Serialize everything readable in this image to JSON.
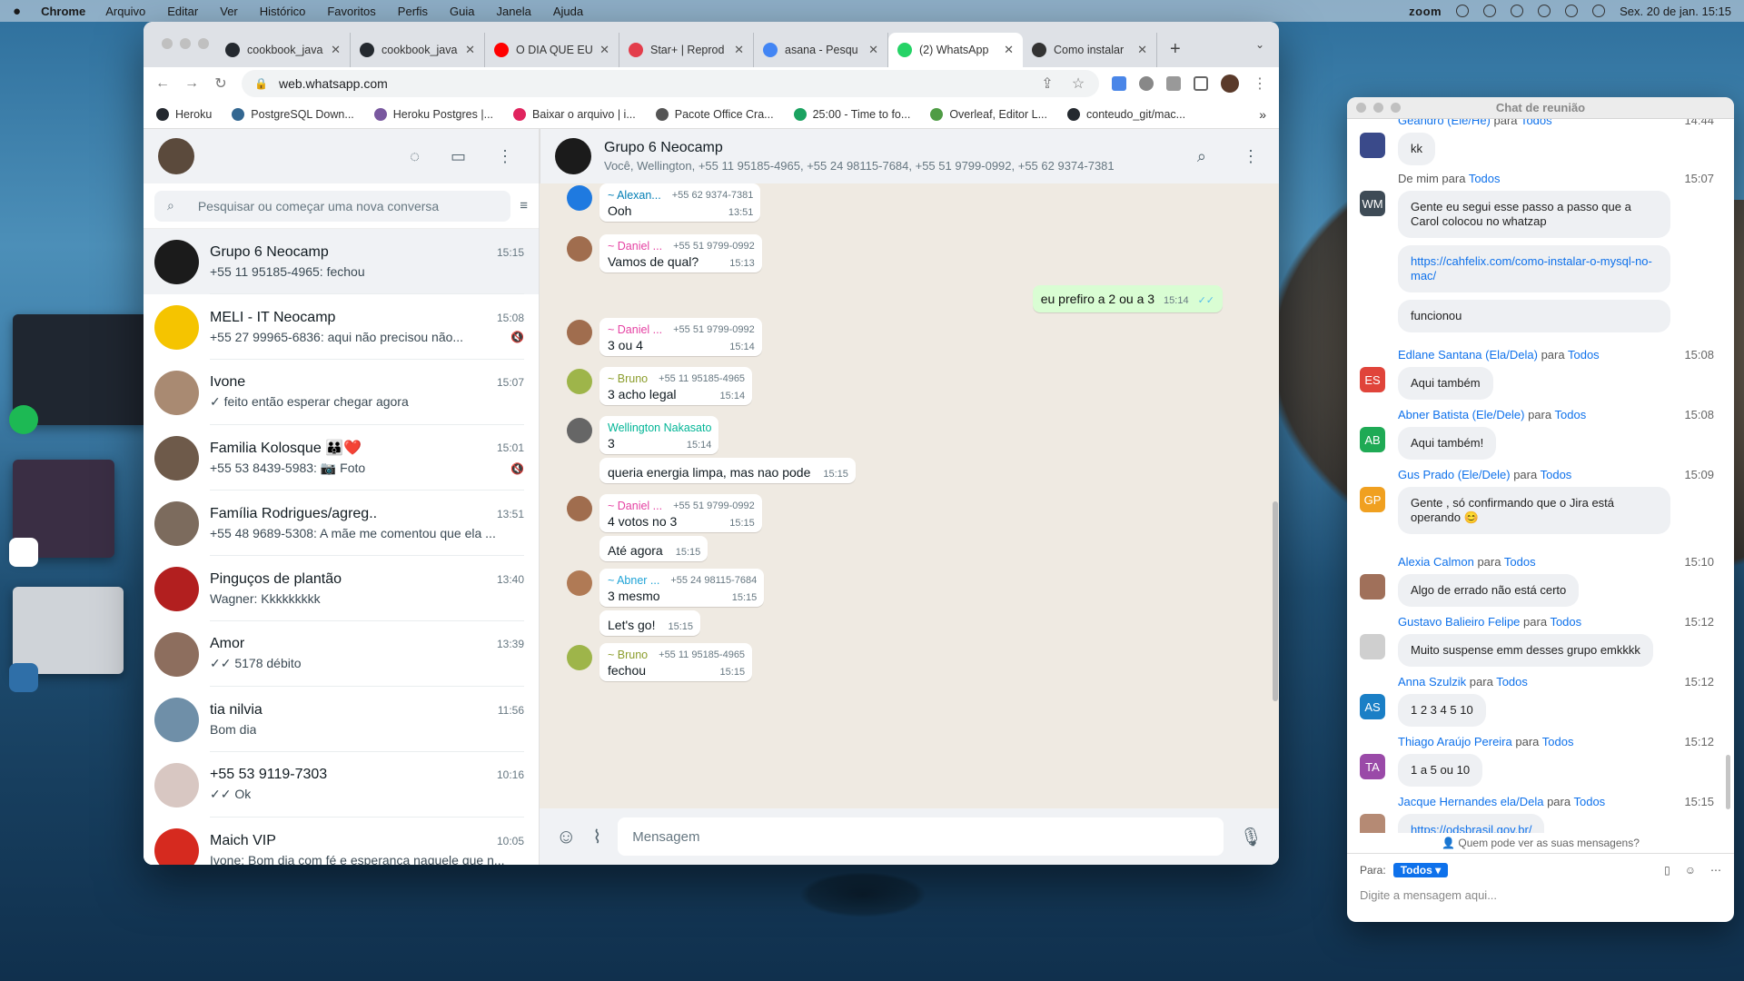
{
  "menubar": {
    "apple": "",
    "app": "Chrome",
    "items": [
      "Arquivo",
      "Editar",
      "Ver",
      "Histórico",
      "Favoritos",
      "Perfis",
      "Guia",
      "Janela",
      "Ajuda"
    ],
    "zoom": "zoom",
    "datetime": "Sex. 20 de jan.  15:15"
  },
  "browser": {
    "tabs": [
      {
        "title": "cookbook_java",
        "color": "#24292f"
      },
      {
        "title": "cookbook_java",
        "color": "#24292f"
      },
      {
        "title": "O DIA QUE EU",
        "color": "#ff0000"
      },
      {
        "title": "Star+ | Reprod",
        "color": "#e33d4b"
      },
      {
        "title": "asana - Pesqu",
        "color": "#4285f4"
      },
      {
        "title": "(2) WhatsApp",
        "color": "#25d366"
      },
      {
        "title": "Como instalar",
        "color": "#333333"
      }
    ],
    "new_tab": "+",
    "url": "web.whatsapp.com",
    "bookmarks": [
      {
        "label": "Heroku",
        "color": "#24292f"
      },
      {
        "label": "PostgreSQL Down...",
        "color": "#336791"
      },
      {
        "label": "Heroku Postgres |...",
        "color": "#79589f"
      },
      {
        "label": "Baixar o arquivo | i...",
        "color": "#e0245e"
      },
      {
        "label": "Pacote Office Cra...",
        "color": "#555555"
      },
      {
        "label": "25:00 - Time to fo...",
        "color": "#1aa260"
      },
      {
        "label": "Overleaf, Editor L...",
        "color": "#4f9c45"
      },
      {
        "label": "conteudo_git/mac...",
        "color": "#24292f"
      }
    ],
    "bookmarks_more": "»"
  },
  "whatsapp": {
    "search_placeholder": "Pesquisar ou começar uma nova conversa",
    "chats": [
      {
        "name": "Grupo 6 Neocamp",
        "time": "15:15",
        "preview": "+55 11 95185-4965: fechou",
        "muted": false,
        "avatar": "#1b1b1b",
        "selected": true
      },
      {
        "name": "MELI - IT Neocamp",
        "time": "15:08",
        "preview": "+55 27 99965-6836: aqui não precisou não...",
        "muted": true,
        "avatar": "#f5c400"
      },
      {
        "name": "Ivone",
        "time": "15:07",
        "preview": "✓ feito então esperar chegar agora",
        "muted": false,
        "avatar": "#a98a72"
      },
      {
        "name": "Familia Kolosque 👪❤️",
        "time": "15:01",
        "preview": "+55 53 8439-5983: 📷 Foto",
        "muted": true,
        "avatar": "#6e5a4a"
      },
      {
        "name": "Família Rodrigues/agreg..",
        "time": "13:51",
        "preview": "+55 48 9689-5308: A mãe me comentou que ela ...",
        "muted": false,
        "avatar": "#7c6b5d"
      },
      {
        "name": "Pinguços de plantão",
        "time": "13:40",
        "preview": "Wagner: Kkkkkkkkk",
        "muted": false,
        "avatar": "#b21f1f"
      },
      {
        "name": "Amor",
        "time": "13:39",
        "preview": "✓✓ 5178 débito",
        "muted": false,
        "avatar": "#8d6e5e"
      },
      {
        "name": "tia nilvia",
        "time": "11:56",
        "preview": "Bom dia",
        "muted": false,
        "avatar": "#6f8fa8"
      },
      {
        "name": "+55 53 9119-7303",
        "time": "10:16",
        "preview": "✓✓ Ok",
        "muted": false,
        "avatar": "#d8c7c2"
      },
      {
        "name": "Maich VIP",
        "time": "10:05",
        "preview": "Ivone: Bom dia com fé e esperança naquele que n...",
        "muted": false,
        "avatar": "#d62a1f"
      }
    ],
    "conversation": {
      "title": "Grupo 6 Neocamp",
      "members": "Você, Wellington, +55 11 95185-4965, +55 24 98115-7684, +55 51 9799-0992, +55 62 9374-7381",
      "messages": [
        {
          "sender": "~ Alexan...",
          "phone": "+55 62 9374-7381",
          "color": "#027eb5",
          "avatar": "#1f7ae0",
          "lines": [
            {
              "text": "Ooh",
              "time": "13:51"
            }
          ]
        },
        {
          "sender": "~ Daniel ...",
          "phone": "+55 51 9799-0992",
          "color": "#e542a3",
          "avatar": "#a06d4e",
          "lines": [
            {
              "text": "Vamos de qual?",
              "time": "15:13"
            }
          ]
        },
        {
          "sender": "~ Daniel ...",
          "phone": "+55 51 9799-0992",
          "color": "#e542a3",
          "avatar": "#a06d4e",
          "lines": [
            {
              "text": "3 ou 4",
              "time": "15:14"
            }
          ]
        },
        {
          "sender": "~ Bruno",
          "phone": "+55 11 95185-4965",
          "color": "#8b9d2c",
          "avatar": "#9eb54a",
          "lines": [
            {
              "text": "3 acho legal",
              "time": "15:14"
            }
          ]
        },
        {
          "sender": "Wellington Nakasato",
          "phone": "",
          "color": "#02b596",
          "avatar": "#666666",
          "lines": [
            {
              "text": "3",
              "time": "15:14"
            },
            {
              "text": "queria energia limpa, mas nao pode",
              "time": "15:15"
            }
          ]
        },
        {
          "sender": "~ Daniel ...",
          "phone": "+55 51 9799-0992",
          "color": "#e542a3",
          "avatar": "#a06d4e",
          "lines": [
            {
              "text": "4 votos no 3",
              "time": "15:15"
            },
            {
              "text": "Até agora",
              "time": "15:15"
            }
          ]
        },
        {
          "sender": "~ Abner ...",
          "phone": "+55 24 98115-7684",
          "color": "#1fa3d6",
          "avatar": "#b07a55",
          "lines": [
            {
              "text": "3 mesmo",
              "time": "15:15"
            },
            {
              "text": "Let's go!",
              "time": "15:15"
            }
          ]
        },
        {
          "sender": "~ Bruno",
          "phone": "+55 11 95185-4965",
          "color": "#8b9d2c",
          "avatar": "#9eb54a",
          "lines": [
            {
              "text": "fechou",
              "time": "15:15"
            }
          ]
        }
      ],
      "outgoing": {
        "text": "eu prefiro a 2 ou a 3",
        "time": "15:14"
      },
      "composer_placeholder": "Mensagem"
    }
  },
  "zoom_chat": {
    "title": "Chat de reunião",
    "para": "para",
    "entries": [
      {
        "who": "Geandro (Ele/He)",
        "to": "Todos",
        "time": "14:44",
        "initials": "",
        "avcolor": "#3a4a8a",
        "bubbles": [
          {
            "text": "kk",
            "link": false
          }
        ]
      },
      {
        "who": "De mim",
        "to": "Todos",
        "time": "15:07",
        "initials": "WM",
        "avcolor": "#3e4b56",
        "self": true,
        "bubbles": [
          {
            "text": "Gente eu segui esse passo a passo que a Carol colocou no whatzap",
            "link": false
          },
          {
            "text": "https://cahfelix.com/como-instalar-o-mysql-no-mac/",
            "link": true
          },
          {
            "text": "funcionou",
            "link": false
          }
        ]
      },
      {
        "who": "Edlane Santana (Ela/Dela)",
        "to": "Todos",
        "time": "15:08",
        "initials": "ES",
        "avcolor": "#e0443a",
        "bubbles": [
          {
            "text": "Aqui também",
            "link": false
          }
        ]
      },
      {
        "who": "Abner Batista (Ele/Dele)",
        "to": "Todos",
        "time": "15:08",
        "initials": "AB",
        "avcolor": "#1faa55",
        "bubbles": [
          {
            "text": "Aqui também!",
            "link": false
          }
        ]
      },
      {
        "who": "Gus Prado (Ele/Dele)",
        "to": "Todos",
        "time": "15:09",
        "initials": "GP",
        "avcolor": "#f0a020",
        "bubbles": [
          {
            "text": "Gente , só confirmando que o Jira está operando 😊",
            "link": false
          }
        ]
      },
      {
        "who": "Alexia Calmon",
        "to": "Todos",
        "time": "15:10",
        "initials": "",
        "avcolor": "#a0705a",
        "bubbles": [
          {
            "text": "Algo de errado não está certo",
            "link": false
          }
        ]
      },
      {
        "who": "Gustavo Balieiro Felipe",
        "to": "Todos",
        "time": "15:12",
        "initials": "",
        "avcolor": "#cfcfcf",
        "bubbles": [
          {
            "text": "Muito suspense emm desses grupo emkkkk",
            "link": false
          }
        ]
      },
      {
        "who": "Anna Szulzik",
        "to": "Todos",
        "time": "15:12",
        "initials": "AS",
        "avcolor": "#1a7fc6",
        "bubbles": [
          {
            "text": "1 2 3 4 5 10",
            "link": false
          }
        ]
      },
      {
        "who": "Thiago Araújo Pereira",
        "to": "Todos",
        "time": "15:12",
        "initials": "TA",
        "avcolor": "#9a4aa8",
        "bubbles": [
          {
            "text": "1 a 5 ou 10",
            "link": false
          }
        ]
      },
      {
        "who": "Jacque Hernandes ela/Dela",
        "to": "Todos",
        "time": "15:15",
        "initials": "",
        "avcolor": "#b58a74",
        "bubbles": [
          {
            "text": "https://odsbrasil.gov.br/",
            "link": true
          }
        ]
      }
    ],
    "privacy": "Quem pode ver as suas mensagens?",
    "to_label": "Para:",
    "to_value": "Todos ▾",
    "input_placeholder": "Digite a mensagem aqui..."
  }
}
